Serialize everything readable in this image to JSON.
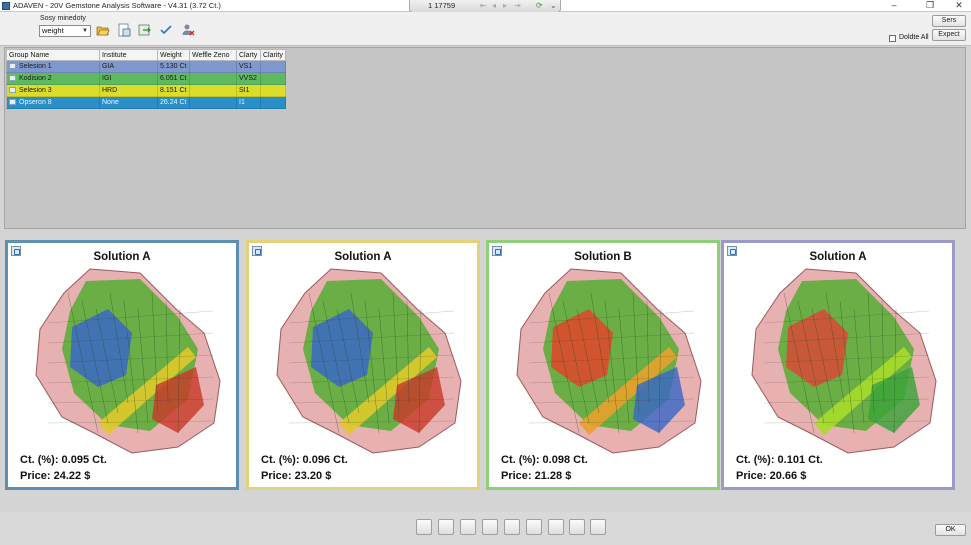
{
  "window": {
    "title": "ADAVEN - 20V Gemstone Analysis Software - V4.31 (3.72 Ct.)",
    "center_count": "1 17759",
    "controls": [
      "–",
      "❐",
      "✕"
    ]
  },
  "toolbar": {
    "sort_label": "Sosy minedoty",
    "sort_value": "weight",
    "delete_all_label": "Doldte All",
    "buttons": [
      "Sers",
      "Expect"
    ],
    "icons": [
      "folder-open-icon",
      "save-document-icon",
      "export-icon",
      "checkmark-icon",
      "remove-user-icon"
    ]
  },
  "table": {
    "columns": [
      "Group Name",
      "Institute",
      "Weight",
      "Weffle Zeno",
      "Clarty",
      "Clarity"
    ],
    "rows": [
      [
        "Selesion 1",
        "GIA",
        "5.130 Ct",
        "",
        "VS1",
        ""
      ],
      [
        "Kodision 2",
        "IGI",
        "6.051 Ct",
        "",
        "VVS2",
        ""
      ],
      [
        "Selesion 3",
        "HRD",
        "8.151 Ct",
        "",
        "SI1",
        ""
      ],
      [
        "Opseron 8",
        "None",
        "26.24 Ct",
        "",
        "I1",
        ""
      ]
    ],
    "row_colors": [
      "#7f99cf",
      "#5fb95f",
      "#dcdc2a",
      "#2a8fc8"
    ]
  },
  "solutions": [
    {
      "title": "Solution A",
      "ct": "Ct. (%): 0.095 Ct.",
      "price": "Price: 24.22 $",
      "border": "#5f8fb0",
      "palette": [
        "#3a68c6",
        "#e0c92a",
        "#c83a2a"
      ]
    },
    {
      "title": "Solution A",
      "ct": "Ct. (%): 0.096 Ct.",
      "price": "Price: 23.20 $",
      "border": "#e3d27a",
      "palette": [
        "#3a68c6",
        "#e0c92a",
        "#c83a2a"
      ]
    },
    {
      "title": "Solution B",
      "ct": "Ct. (%): 0.098 Ct.",
      "price": "Price: 21.28 $",
      "border": "#8fcf7a",
      "palette": [
        "#e2452a",
        "#e9a12a",
        "#3a68c6"
      ]
    },
    {
      "title": "Solution A",
      "ct": "Ct. (%): 0.101 Ct.",
      "price": "Price: 20.66 $",
      "border": "#9a9ac8",
      "palette": [
        "#d84a36",
        "#a8dd2a",
        "#3aa33a"
      ]
    }
  ],
  "bottom": {
    "ok_label": "OK",
    "tools": [
      "gem-view-icon",
      "brush-icon",
      "facets-icon",
      "pavilion-icon",
      "crown-icon",
      "square-cut-icon",
      "heart-cut-icon",
      "ring-icon",
      "round-cut-icon"
    ]
  }
}
